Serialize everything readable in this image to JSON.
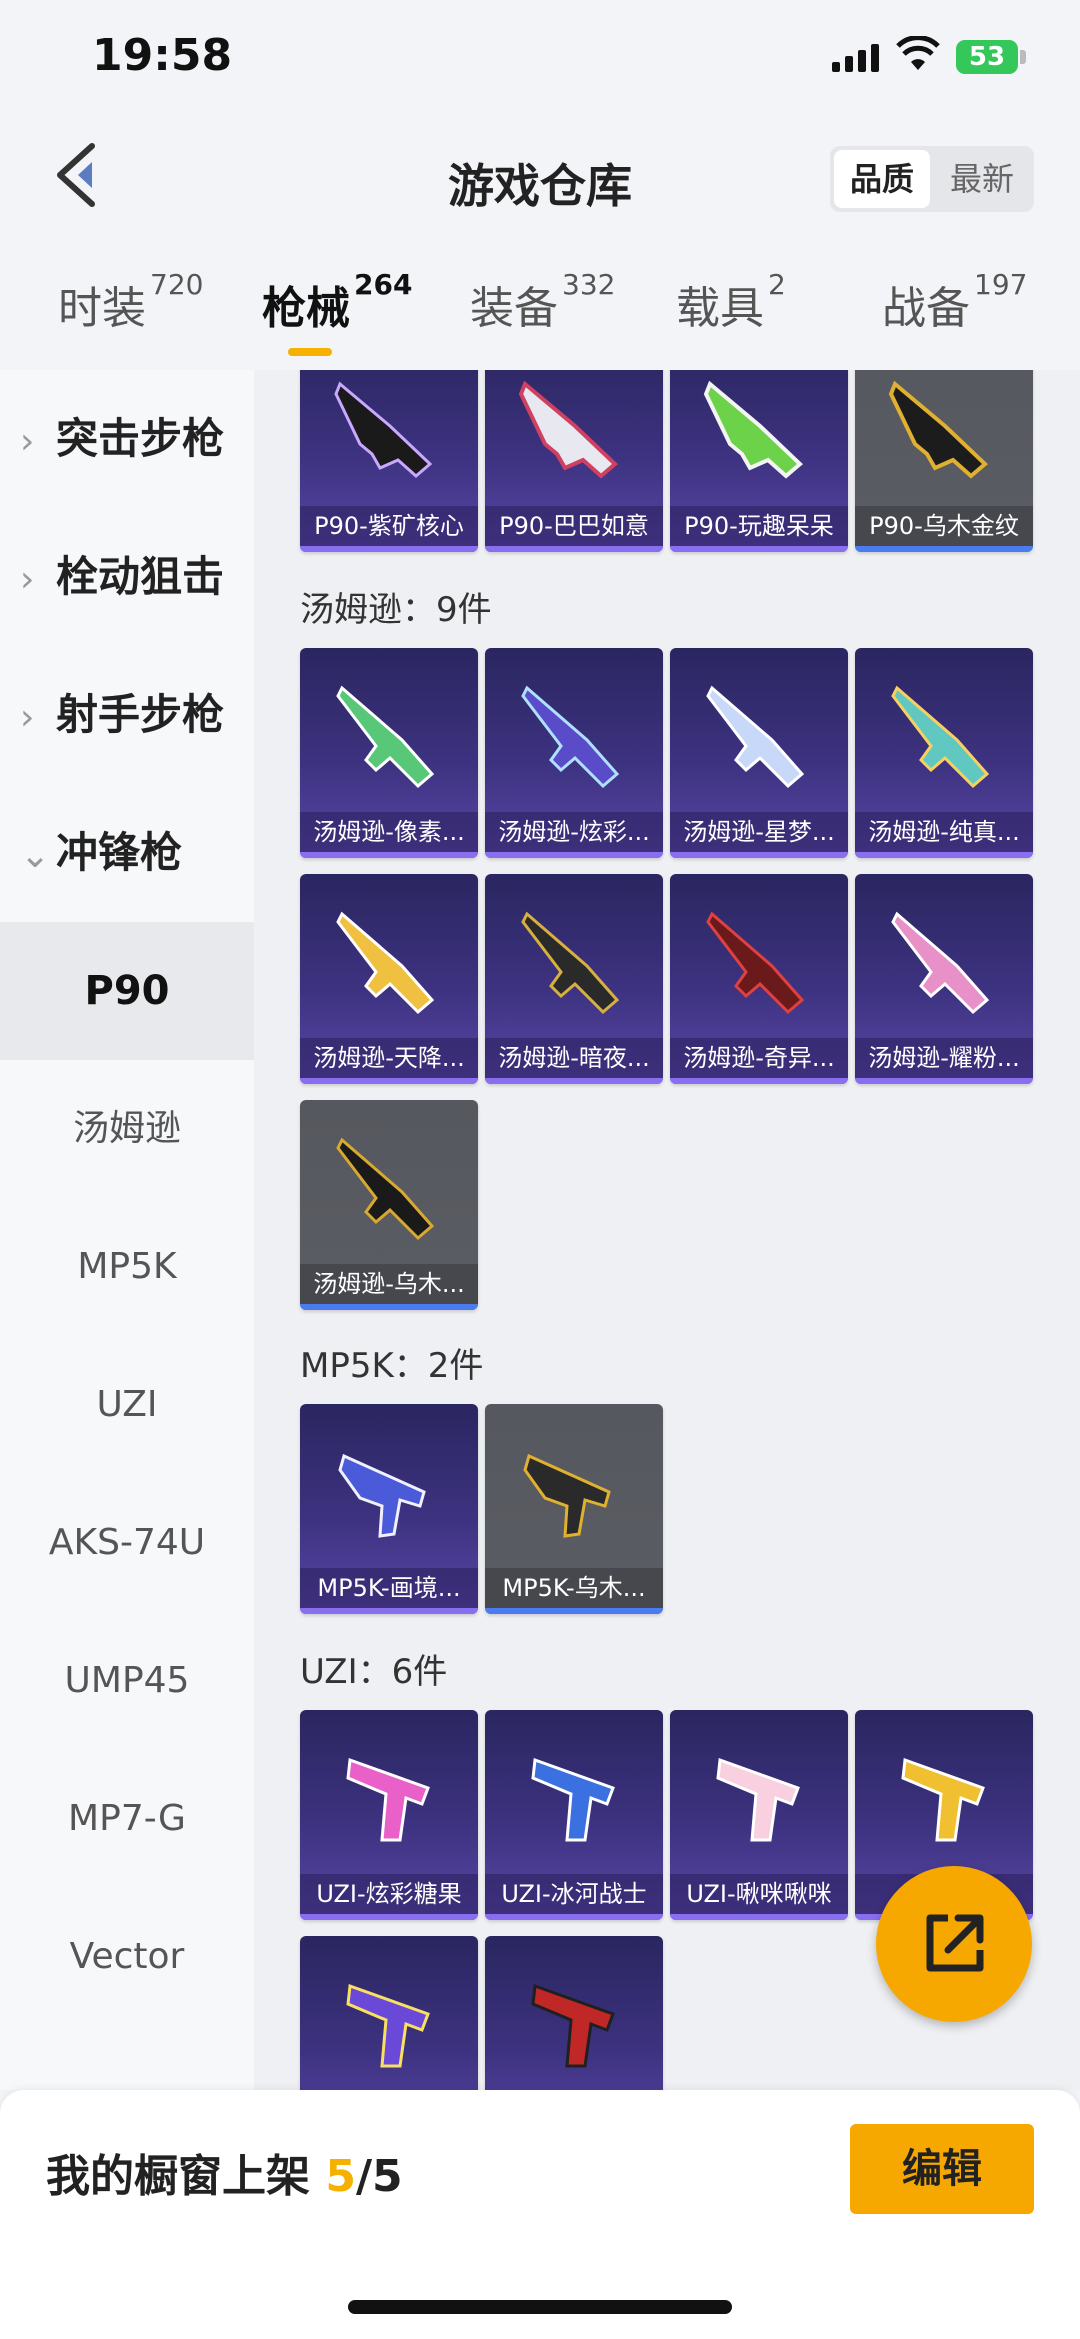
{
  "status": {
    "time": "19:58",
    "battery": "53"
  },
  "header": {
    "title": "游戏仓库",
    "sort_options": [
      "品质",
      "最新"
    ]
  },
  "tabs": [
    {
      "label": "时装",
      "count": "720"
    },
    {
      "label": "枪械",
      "count": "264"
    },
    {
      "label": "装备",
      "count": "332"
    },
    {
      "label": "载具",
      "count": "2"
    },
    {
      "label": "战备",
      "count": "197"
    }
  ],
  "sidebar": {
    "categories": [
      "突击步枪",
      "栓动狙击",
      "射手步枪",
      "冲锋枪"
    ],
    "items": [
      "P90",
      "汤姆逊",
      "MP5K",
      "UZI",
      "AKS-74U",
      "UMP45",
      "MP7-G",
      "Vector"
    ]
  },
  "groups": {
    "p90": {
      "items": [
        "P90-紫矿核心",
        "P90-巴巴如意",
        "P90-玩趣呆呆",
        "P90-乌木金纹"
      ]
    },
    "thompson": {
      "title": "汤姆逊：9件",
      "items": [
        "汤姆逊-像素...",
        "汤姆逊-炫彩...",
        "汤姆逊-星梦...",
        "汤姆逊-纯真...",
        "汤姆逊-天降...",
        "汤姆逊-暗夜...",
        "汤姆逊-奇异...",
        "汤姆逊-耀粉...",
        "汤姆逊-乌木..."
      ]
    },
    "mp5k": {
      "title": "MP5K：2件",
      "items": [
        "MP5K-画境...",
        "MP5K-乌木..."
      ]
    },
    "uzi": {
      "title": "UZI：6件",
      "items": [
        "UZI-炫彩糖果",
        "UZI-冰河战士",
        "UZI-啾咪啾咪",
        "U",
        "",
        ""
      ]
    }
  },
  "footer": {
    "label": "我的橱窗上架",
    "count": "5",
    "total": "/5",
    "edit": "编辑"
  },
  "colors": {
    "accent": "#f7a800",
    "card_purple": "#3d3280",
    "card_gray": "#55585e"
  }
}
